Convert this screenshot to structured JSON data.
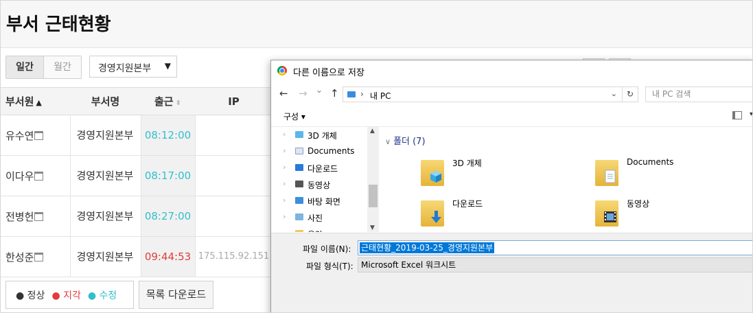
{
  "page": {
    "title": "부서 근태현황"
  },
  "view_toggle": {
    "daily": "일간",
    "monthly": "월간"
  },
  "department_select": {
    "value": "경영지원본부",
    "caret": "▼"
  },
  "table": {
    "headers": {
      "member": "부서원",
      "member_sort": "▲",
      "dept": "부서명",
      "checkin": "출근",
      "checkin_sort": "⬍",
      "ip": "IP"
    },
    "rows": [
      {
        "name": "유수연",
        "dept": "경영지원본부",
        "time": "08:12:00",
        "ip": ""
      },
      {
        "name": "이다우",
        "dept": "경영지원본부",
        "time": "08:17:00",
        "ip": ""
      },
      {
        "name": "전병헌",
        "dept": "경영지원본부",
        "time": "08:27:00",
        "ip": ""
      },
      {
        "name": "한성준",
        "dept": "경영지원본부",
        "time": "09:44:53",
        "ip": "175.115.92.151"
      }
    ]
  },
  "legend": {
    "normal": "정상",
    "late": "지각",
    "edited": "수정",
    "dot": "●"
  },
  "download_button": "목록 다운로드",
  "colors": {
    "late": "#e03c3c",
    "edited": "#31bfcd",
    "normal": "#333333"
  },
  "dialog": {
    "title": "다른 이름으로 저장",
    "nav": {
      "back": "←",
      "forward": "→",
      "recent": "⌄",
      "up": "↑"
    },
    "address": {
      "separator": "›",
      "path": "내 PC",
      "dropdown": "⌄",
      "refresh": "↻"
    },
    "search_placeholder": "내 PC 검색",
    "organize": "구성 ▾",
    "view_dropdown": "▾",
    "tree": [
      {
        "label": "3D 개체",
        "icon": "cube-icon"
      },
      {
        "label": "Documents",
        "icon": "document-icon"
      },
      {
        "label": "다운로드",
        "icon": "download-icon"
      },
      {
        "label": "동영상",
        "icon": "video-icon"
      },
      {
        "label": "바탕 화면",
        "icon": "desktop-icon"
      },
      {
        "label": "사진",
        "icon": "picture-icon"
      },
      {
        "label": "음악",
        "icon": "music-icon"
      }
    ],
    "tree_chevron": "›",
    "group_header": {
      "chevron": "∨",
      "label": "폴더 (7)"
    },
    "folders": [
      {
        "label": "3D 개체"
      },
      {
        "label": "Documents"
      },
      {
        "label": "다운로드"
      },
      {
        "label": "동영상"
      }
    ],
    "filename_label": "파일 이름(N):",
    "filename_value": "근태현황_2019-03-25_경영지원본부",
    "filetype_label": "파일 형식(T):",
    "filetype_value": "Microsoft Excel 워크시트"
  }
}
